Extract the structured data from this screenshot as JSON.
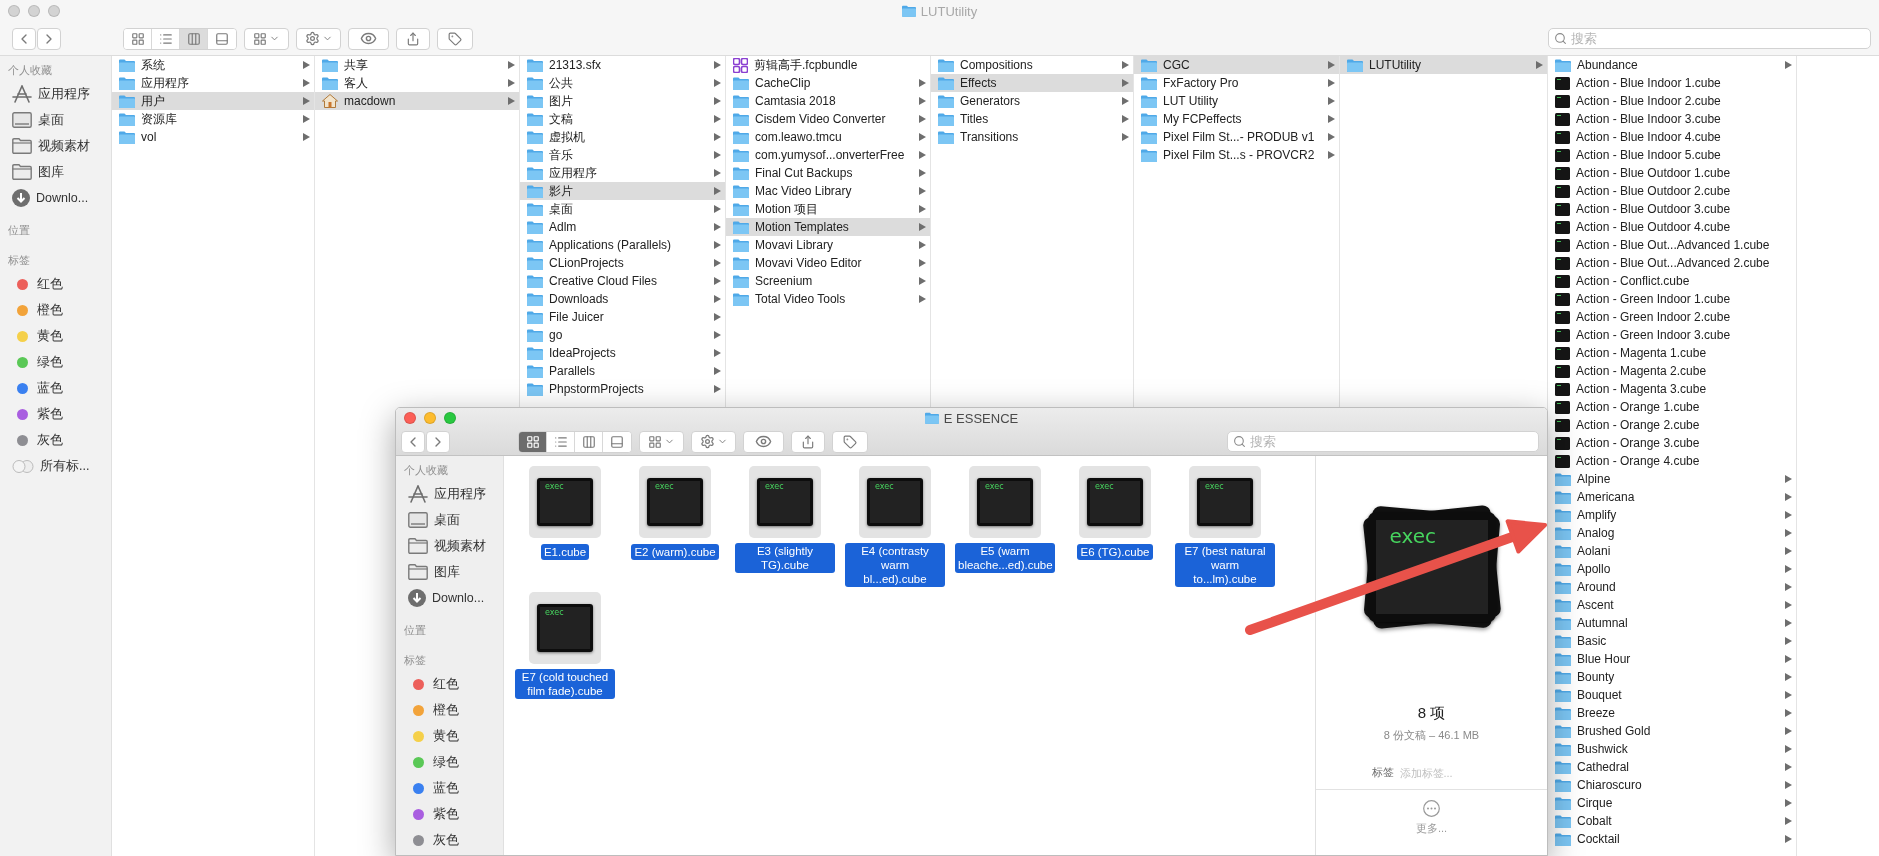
{
  "back_window": {
    "title": "LUTUtility",
    "active": false,
    "toolbar": {
      "view_modes": [
        {
          "kind": "icon",
          "selected": false
        },
        {
          "kind": "list",
          "selected": false
        },
        {
          "kind": "column",
          "selected": true
        },
        {
          "kind": "gallery",
          "selected": false
        }
      ]
    },
    "search": {
      "placeholder": "搜索"
    },
    "sidebar": {
      "sections": [
        {
          "title": "个人收藏",
          "items": [
            {
              "label": "应用程序",
              "kind": "apps"
            },
            {
              "label": "桌面",
              "kind": "desktop"
            },
            {
              "label": "视频素材",
              "kind": "folder"
            },
            {
              "label": "图库",
              "kind": "folder"
            },
            {
              "label": "Downlo...",
              "kind": "download"
            }
          ]
        },
        {
          "title": "位置"
        },
        {
          "title": "标签",
          "items": [
            {
              "label": "红色",
              "kind": "tag",
              "color": "#ec5f5a"
            },
            {
              "label": "橙色",
              "kind": "tag",
              "color": "#f2a33a"
            },
            {
              "label": "黄色",
              "kind": "tag",
              "color": "#f5d04a"
            },
            {
              "label": "绿色",
              "kind": "tag",
              "color": "#5ac856"
            },
            {
              "label": "蓝色",
              "kind": "tag",
              "color": "#3a80f0"
            },
            {
              "label": "紫色",
              "kind": "tag",
              "color": "#a95ee0"
            },
            {
              "label": "灰色",
              "kind": "tag",
              "color": "#8e8e93"
            },
            {
              "label": "所有标...",
              "kind": "all_tags"
            }
          ]
        }
      ]
    },
    "columns": [
      {
        "items": [
          {
            "name": "系统",
            "kind": "folder",
            "selected": false,
            "arrow": true
          },
          {
            "name": "应用程序",
            "kind": "folder",
            "selected": false,
            "arrow": true
          },
          {
            "name": "用户",
            "kind": "folder",
            "selected": true,
            "arrow": true
          },
          {
            "name": "资源库",
            "kind": "folder",
            "selected": false,
            "arrow": true
          },
          {
            "name": "vol",
            "kind": "folder",
            "selected": false,
            "arrow": true
          }
        ]
      },
      {
        "items": [
          {
            "name": "共享",
            "kind": "folder",
            "selected": false,
            "arrow": true
          },
          {
            "name": "客人",
            "kind": "folder",
            "selected": false,
            "arrow": true
          },
          {
            "name": "macdown",
            "kind": "home",
            "selected": true,
            "arrow": true
          }
        ]
      },
      {
        "items": [
          {
            "name": "21313.sfx",
            "kind": "folder",
            "selected": false,
            "arrow": true
          },
          {
            "name": "公共",
            "kind": "folder",
            "selected": false,
            "arrow": true
          },
          {
            "name": "图片",
            "kind": "folder",
            "selected": false,
            "arrow": true
          },
          {
            "name": "文稿",
            "kind": "folder",
            "selected": false,
            "arrow": true
          },
          {
            "name": "虚拟机",
            "kind": "folder",
            "selected": false,
            "arrow": true
          },
          {
            "name": "音乐",
            "kind": "folder",
            "selected": false,
            "arrow": true
          },
          {
            "name": "应用程序",
            "kind": "folder",
            "selected": false,
            "arrow": true
          },
          {
            "name": "影片",
            "kind": "folder",
            "selected": true,
            "arrow": true
          },
          {
            "name": "桌面",
            "kind": "folder",
            "selected": false,
            "arrow": true
          },
          {
            "name": "Adlm",
            "kind": "folder",
            "selected": false,
            "arrow": true
          },
          {
            "name": "Applications (Parallels)",
            "kind": "folder",
            "selected": false,
            "arrow": true
          },
          {
            "name": "CLionProjects",
            "kind": "folder",
            "selected": false,
            "arrow": true
          },
          {
            "name": "Creative Cloud Files",
            "kind": "folder",
            "selected": false,
            "arrow": true
          },
          {
            "name": "Downloads",
            "kind": "folder",
            "selected": false,
            "arrow": true
          },
          {
            "name": "File Juicer",
            "kind": "folder",
            "selected": false,
            "arrow": true
          },
          {
            "name": "go",
            "kind": "folder",
            "selected": false,
            "arrow": true
          },
          {
            "name": "IdeaProjects",
            "kind": "folder",
            "selected": false,
            "arrow": true
          },
          {
            "name": "Parallels",
            "kind": "folder",
            "selected": false,
            "arrow": true
          },
          {
            "name": "PhpstormProjects",
            "kind": "folder",
            "selected": false,
            "arrow": true
          }
        ]
      },
      {
        "items": [
          {
            "name": "剪辑高手.fcpbundle",
            "kind": "bundle",
            "selected": false,
            "arrow": false
          },
          {
            "name": "CacheClip",
            "kind": "folder",
            "selected": false,
            "arrow": true
          },
          {
            "name": "Camtasia 2018",
            "kind": "folder",
            "selected": false,
            "arrow": true
          },
          {
            "name": "Cisdem Video Converter",
            "kind": "folder",
            "selected": false,
            "arrow": true
          },
          {
            "name": "com.leawo.tmcu",
            "kind": "folder",
            "selected": false,
            "arrow": true
          },
          {
            "name": "com.yumysof...onverterFree",
            "kind": "folder",
            "selected": false,
            "arrow": true
          },
          {
            "name": "Final Cut Backups",
            "kind": "folder",
            "selected": false,
            "arrow": true
          },
          {
            "name": "Mac Video Library",
            "kind": "folder",
            "selected": false,
            "arrow": true
          },
          {
            "name": "Motion 项目",
            "kind": "folder",
            "selected": false,
            "arrow": true
          },
          {
            "name": "Motion Templates",
            "kind": "folder",
            "selected": true,
            "arrow": true
          },
          {
            "name": "Movavi Library",
            "kind": "folder",
            "selected": false,
            "arrow": true
          },
          {
            "name": "Movavi Video Editor",
            "kind": "folder",
            "selected": false,
            "arrow": true
          },
          {
            "name": "Screenium",
            "kind": "folder",
            "selected": false,
            "arrow": true
          },
          {
            "name": "Total Video Tools",
            "kind": "folder",
            "selected": false,
            "arrow": true
          }
        ]
      },
      {
        "items": [
          {
            "name": "Compositions",
            "kind": "folder",
            "selected": false,
            "arrow": true
          },
          {
            "name": "Effects",
            "kind": "folder",
            "selected": true,
            "arrow": true
          },
          {
            "name": "Generators",
            "kind": "folder",
            "selected": false,
            "arrow": true
          },
          {
            "name": "Titles",
            "kind": "folder",
            "selected": false,
            "arrow": true
          },
          {
            "name": "Transitions",
            "kind": "folder",
            "selected": false,
            "arrow": true
          }
        ]
      },
      {
        "items": [
          {
            "name": "CGC",
            "kind": "folder",
            "selected": true,
            "arrow": true
          },
          {
            "name": "FxFactory Pro",
            "kind": "folder",
            "selected": false,
            "arrow": true
          },
          {
            "name": "LUT Utility",
            "kind": "folder",
            "selected": false,
            "arrow": true
          },
          {
            "name": "My FCPeffects",
            "kind": "folder",
            "selected": false,
            "arrow": true
          },
          {
            "name": "Pixel Film St...- PRODUB v1",
            "kind": "folder",
            "selected": false,
            "arrow": true
          },
          {
            "name": "Pixel Film St...s - PROVCR2",
            "kind": "folder",
            "selected": false,
            "arrow": true
          }
        ]
      },
      {
        "items": [
          {
            "name": "LUTUtility",
            "kind": "folder",
            "selected": true,
            "arrow": true
          }
        ]
      },
      {
        "items": [
          {
            "name": "Abundance",
            "kind": "folder",
            "selected": false,
            "arrow": true
          },
          {
            "name": "Action - Blue Indoor 1.cube",
            "kind": "cube",
            "selected": false,
            "arrow": false
          },
          {
            "name": "Action - Blue Indoor 2.cube",
            "kind": "cube",
            "selected": false,
            "arrow": false
          },
          {
            "name": "Action - Blue Indoor 3.cube",
            "kind": "cube",
            "selected": false,
            "arrow": false
          },
          {
            "name": "Action - Blue Indoor 4.cube",
            "kind": "cube",
            "selected": false,
            "arrow": false
          },
          {
            "name": "Action - Blue Indoor 5.cube",
            "kind": "cube",
            "selected": false,
            "arrow": false
          },
          {
            "name": "Action - Blue Outdoor 1.cube",
            "kind": "cube",
            "selected": false,
            "arrow": false
          },
          {
            "name": "Action - Blue Outdoor 2.cube",
            "kind": "cube",
            "selected": false,
            "arrow": false
          },
          {
            "name": "Action - Blue Outdoor 3.cube",
            "kind": "cube",
            "selected": false,
            "arrow": false
          },
          {
            "name": "Action - Blue Outdoor 4.cube",
            "kind": "cube",
            "selected": false,
            "arrow": false
          },
          {
            "name": "Action - Blue Out...Advanced 1.cube",
            "kind": "cube",
            "selected": false,
            "arrow": false
          },
          {
            "name": "Action - Blue Out...Advanced 2.cube",
            "kind": "cube",
            "selected": false,
            "arrow": false
          },
          {
            "name": "Action - Conflict.cube",
            "kind": "cube",
            "selected": false,
            "arrow": false
          },
          {
            "name": "Action - Green Indoor 1.cube",
            "kind": "cube",
            "selected": false,
            "arrow": false
          },
          {
            "name": "Action - Green Indoor 2.cube",
            "kind": "cube",
            "selected": false,
            "arrow": false
          },
          {
            "name": "Action - Green Indoor 3.cube",
            "kind": "cube",
            "selected": false,
            "arrow": false
          },
          {
            "name": "Action - Magenta 1.cube",
            "kind": "cube",
            "selected": false,
            "arrow": false
          },
          {
            "name": "Action - Magenta 2.cube",
            "kind": "cube",
            "selected": false,
            "arrow": false
          },
          {
            "name": "Action - Magenta 3.cube",
            "kind": "cube",
            "selected": false,
            "arrow": false
          },
          {
            "name": "Action - Orange 1.cube",
            "kind": "cube",
            "selected": false,
            "arrow": false
          },
          {
            "name": "Action - Orange 2.cube",
            "kind": "cube",
            "selected": false,
            "arrow": false
          },
          {
            "name": "Action - Orange 3.cube",
            "kind": "cube",
            "selected": false,
            "arrow": false
          },
          {
            "name": "Action - Orange 4.cube",
            "kind": "cube",
            "selected": false,
            "arrow": false
          },
          {
            "name": "Alpine",
            "kind": "folder",
            "selected": false,
            "arrow": true
          },
          {
            "name": "Americana",
            "kind": "folder",
            "selected": false,
            "arrow": true
          },
          {
            "name": "Amplify",
            "kind": "folder",
            "selected": false,
            "arrow": true
          },
          {
            "name": "Analog",
            "kind": "folder",
            "selected": false,
            "arrow": true
          },
          {
            "name": "Aolani",
            "kind": "folder",
            "selected": false,
            "arrow": true
          },
          {
            "name": "Apollo",
            "kind": "folder",
            "selected": false,
            "arrow": true
          },
          {
            "name": "Around",
            "kind": "folder",
            "selected": false,
            "arrow": true
          },
          {
            "name": "Ascent",
            "kind": "folder",
            "selected": false,
            "arrow": true
          },
          {
            "name": "Autumnal",
            "kind": "folder",
            "selected": false,
            "arrow": true
          },
          {
            "name": "Basic",
            "kind": "folder",
            "selected": false,
            "arrow": true
          },
          {
            "name": "Blue Hour",
            "kind": "folder",
            "selected": false,
            "arrow": true
          },
          {
            "name": "Bounty",
            "kind": "folder",
            "selected": false,
            "arrow": true
          },
          {
            "name": "Bouquet",
            "kind": "folder",
            "selected": false,
            "arrow": true
          },
          {
            "name": "Breeze",
            "kind": "folder",
            "selected": false,
            "arrow": true
          },
          {
            "name": "Brushed Gold",
            "kind": "folder",
            "selected": false,
            "arrow": true
          },
          {
            "name": "Bushwick",
            "kind": "folder",
            "selected": false,
            "arrow": true
          },
          {
            "name": "Cathedral",
            "kind": "folder",
            "selected": false,
            "arrow": true
          },
          {
            "name": "Chiaroscuro",
            "kind": "folder",
            "selected": false,
            "arrow": true
          },
          {
            "name": "Cirque",
            "kind": "folder",
            "selected": false,
            "arrow": true
          },
          {
            "name": "Cobalt",
            "kind": "folder",
            "selected": false,
            "arrow": true
          },
          {
            "name": "Cocktail",
            "kind": "folder",
            "selected": false,
            "arrow": true
          }
        ]
      }
    ]
  },
  "front_window": {
    "title": "E ESSENCE",
    "active": true,
    "toolbar": {
      "view_modes": [
        {
          "kind": "icon",
          "selected": true
        },
        {
          "kind": "list",
          "selected": false
        },
        {
          "kind": "column",
          "selected": false
        },
        {
          "kind": "gallery",
          "selected": false
        }
      ]
    },
    "search": {
      "placeholder": "搜索"
    },
    "sidebar": {
      "sections": [
        {
          "title": "个人收藏",
          "items": [
            {
              "label": "应用程序",
              "kind": "apps"
            },
            {
              "label": "桌面",
              "kind": "desktop"
            },
            {
              "label": "视频素材",
              "kind": "folder"
            },
            {
              "label": "图库",
              "kind": "folder"
            },
            {
              "label": "Downlo...",
              "kind": "download"
            }
          ]
        },
        {
          "title": "位置"
        },
        {
          "title": "标签",
          "items": [
            {
              "label": "红色",
              "kind": "tag",
              "color": "#ec5f5a"
            },
            {
              "label": "橙色",
              "kind": "tag",
              "color": "#f2a33a"
            },
            {
              "label": "黄色",
              "kind": "tag",
              "color": "#f5d04a"
            },
            {
              "label": "绿色",
              "kind": "tag",
              "color": "#5ac856"
            },
            {
              "label": "蓝色",
              "kind": "tag",
              "color": "#3a80f0"
            },
            {
              "label": "紫色",
              "kind": "tag",
              "color": "#a95ee0"
            },
            {
              "label": "灰色",
              "kind": "tag",
              "color": "#8e8e93"
            }
          ]
        }
      ]
    },
    "files": [
      {
        "name": "E1.cube",
        "icon_text": "exec",
        "selected": true
      },
      {
        "name": "E2 (warm).cube",
        "icon_text": "exec",
        "selected": true
      },
      {
        "name": "E3 (slightly TG).cube",
        "icon_text": "exec",
        "selected": true
      },
      {
        "name": "E4 (contrasty warm bl...ed).cube",
        "icon_text": "exec",
        "selected": true
      },
      {
        "name": "E5 (warm bleache...ed).cube",
        "icon_text": "exec",
        "selected": true
      },
      {
        "name": "E6 (TG).cube",
        "icon_text": "exec",
        "selected": true
      },
      {
        "name": "E7 (best natural warm to...lm).cube",
        "icon_text": "exec",
        "selected": true
      },
      {
        "name": "E7 (cold touched film fade).cube",
        "icon_text": "exec",
        "selected": true
      }
    ],
    "preview": {
      "icon_text": "exec",
      "count": "8 项",
      "summary": "8 份文稿 – 46.1 MB",
      "tags_label": "标签",
      "tags_placeholder": "添加标签...",
      "more": "更多..."
    }
  }
}
